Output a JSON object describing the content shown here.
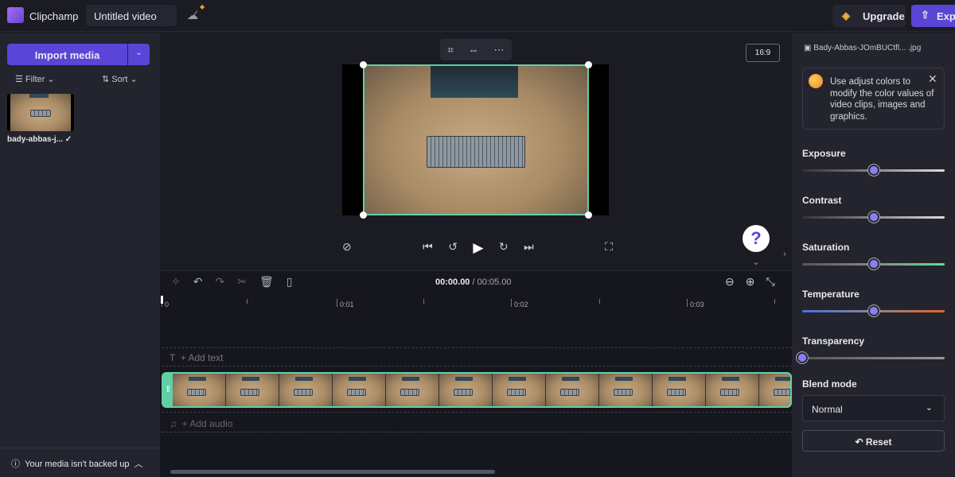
{
  "app": {
    "name": "Clipchamp",
    "project_title": "Untitled video",
    "upgrade_label": "Upgrade",
    "export_label": "Export",
    "accent": "#5a45d6",
    "clip_color": "#5fd0a4"
  },
  "media": {
    "import_label": "Import media",
    "filter_label": "Filter",
    "sort_label": "Sort",
    "items": [
      {
        "name": "bady-abbas-j..."
      }
    ],
    "backup_status": "Your media isn't backed up"
  },
  "preview": {
    "aspect_ratio": "16:9",
    "help": "?"
  },
  "timeline": {
    "current_time": "00:00.00",
    "total_time": "/ 00:05.00",
    "ticks": [
      "0",
      "0:01",
      "0:02",
      "0:03"
    ],
    "add_text": "+ Add text",
    "add_audio": "+ Add audio"
  },
  "properties": {
    "file_name": "Bady-Abbas-JOmBUCtfl...  .jpg",
    "tip": "Use adjust colors to modify the color values of video clips, images and graphics.",
    "sliders": [
      {
        "label": "Exposure",
        "value": 0.5
      },
      {
        "label": "Contrast",
        "value": 0.5
      },
      {
        "label": "Saturation",
        "value": 0.5
      },
      {
        "label": "Temperature",
        "value": 0.5
      },
      {
        "label": "Transparency",
        "value": 0
      }
    ],
    "blend_mode_label": "Blend mode",
    "blend_mode": "Normal",
    "reset_label": "Reset"
  }
}
